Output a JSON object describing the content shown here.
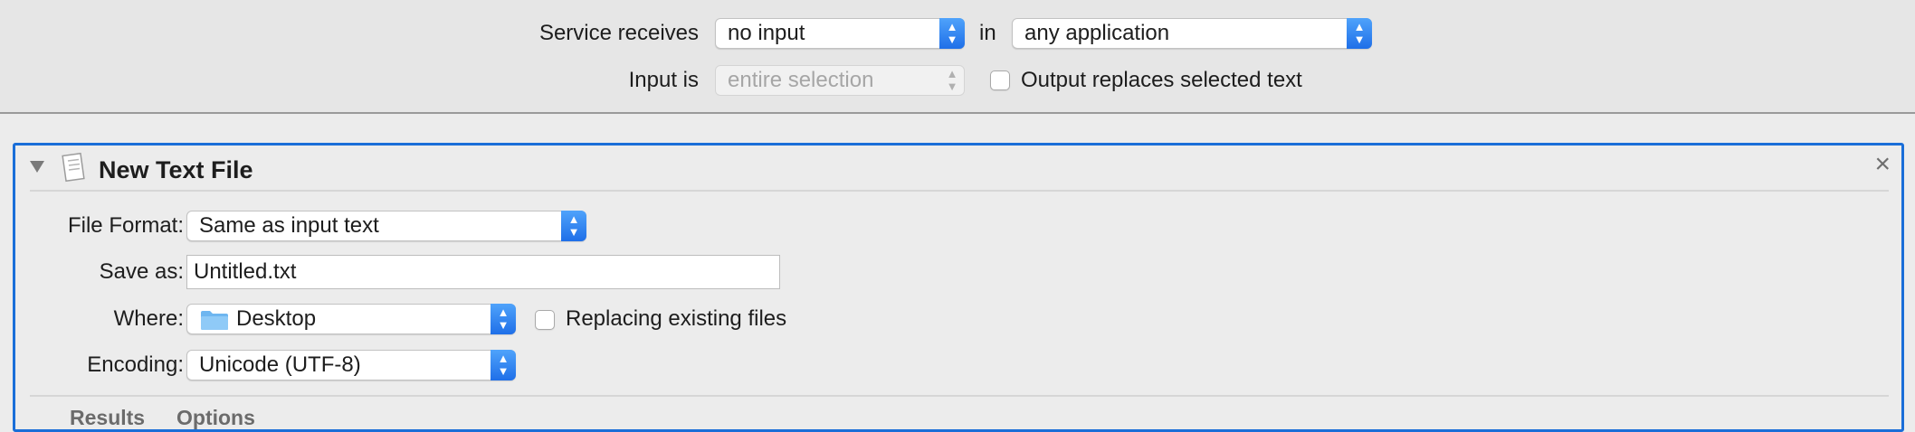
{
  "service": {
    "receives_label": "Service receives",
    "receives_value": "no input",
    "in_label": "in",
    "app_value": "any application",
    "input_is_label": "Input is",
    "input_is_value": "entire selection",
    "output_replaces_label": "Output replaces selected text",
    "output_replaces_checked": false
  },
  "action": {
    "title": "New Text File",
    "icon": "text-document-icon",
    "close_glyph": "×",
    "file_format_label": "File Format:",
    "file_format_value": "Same as input text",
    "save_as_label": "Save as:",
    "save_as_value": "Untitled.txt",
    "where_label": "Where:",
    "where_value": "Desktop",
    "where_icon": "folder-icon",
    "replacing_label": "Replacing existing files",
    "replacing_checked": false,
    "encoding_label": "Encoding:",
    "encoding_value": "Unicode (UTF-8)",
    "tabs": [
      {
        "label": "Results"
      },
      {
        "label": "Options"
      }
    ]
  },
  "colors": {
    "accent": "#1a6ed8",
    "popup_arrow": "#2b7cf0"
  }
}
